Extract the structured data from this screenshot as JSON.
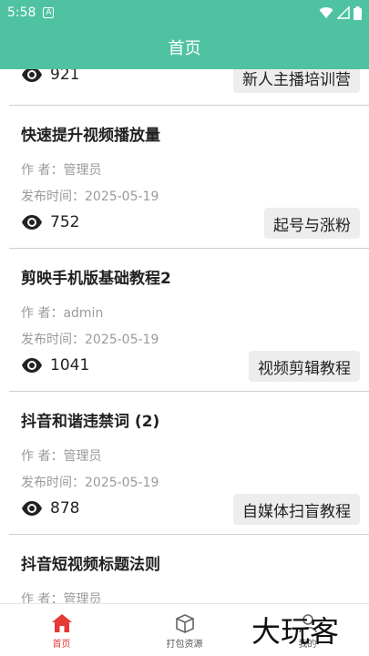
{
  "status": {
    "time": "5:58",
    "a_badge": "A"
  },
  "header": {
    "title": "首页"
  },
  "list": {
    "partial_top": {
      "views": "921",
      "tag": "新人主播培训营"
    },
    "items": [
      {
        "title": "快速提升视频播放量",
        "author": "作  者：管理员",
        "date": "发布时间：2025-05-19",
        "views": "752",
        "tag": "起号与涨粉"
      },
      {
        "title": "剪映手机版基础教程2",
        "author": "作  者：admin",
        "date": "发布时间：2025-05-19",
        "views": "1041",
        "tag": "视频剪辑教程"
      },
      {
        "title": "抖音和谐违禁词 (2)",
        "author": "作  者：管理员",
        "date": "发布时间：2025-05-19",
        "views": "878",
        "tag": "自媒体扫盲教程"
      },
      {
        "title": "抖音短视频标题法则",
        "author": "作  者：管理员"
      }
    ]
  },
  "bottom_nav": {
    "items": [
      {
        "label": "首页",
        "icon": "home-icon",
        "active": true
      },
      {
        "label": "打包资源",
        "icon": "package-icon",
        "active": false
      },
      {
        "label": "我的",
        "icon": "profile-icon",
        "active": false
      }
    ]
  },
  "colors": {
    "accent": "#4FC3A1",
    "active_nav": "#E53935",
    "tag_bg": "#EDEDED"
  },
  "watermark": "大玩客"
}
